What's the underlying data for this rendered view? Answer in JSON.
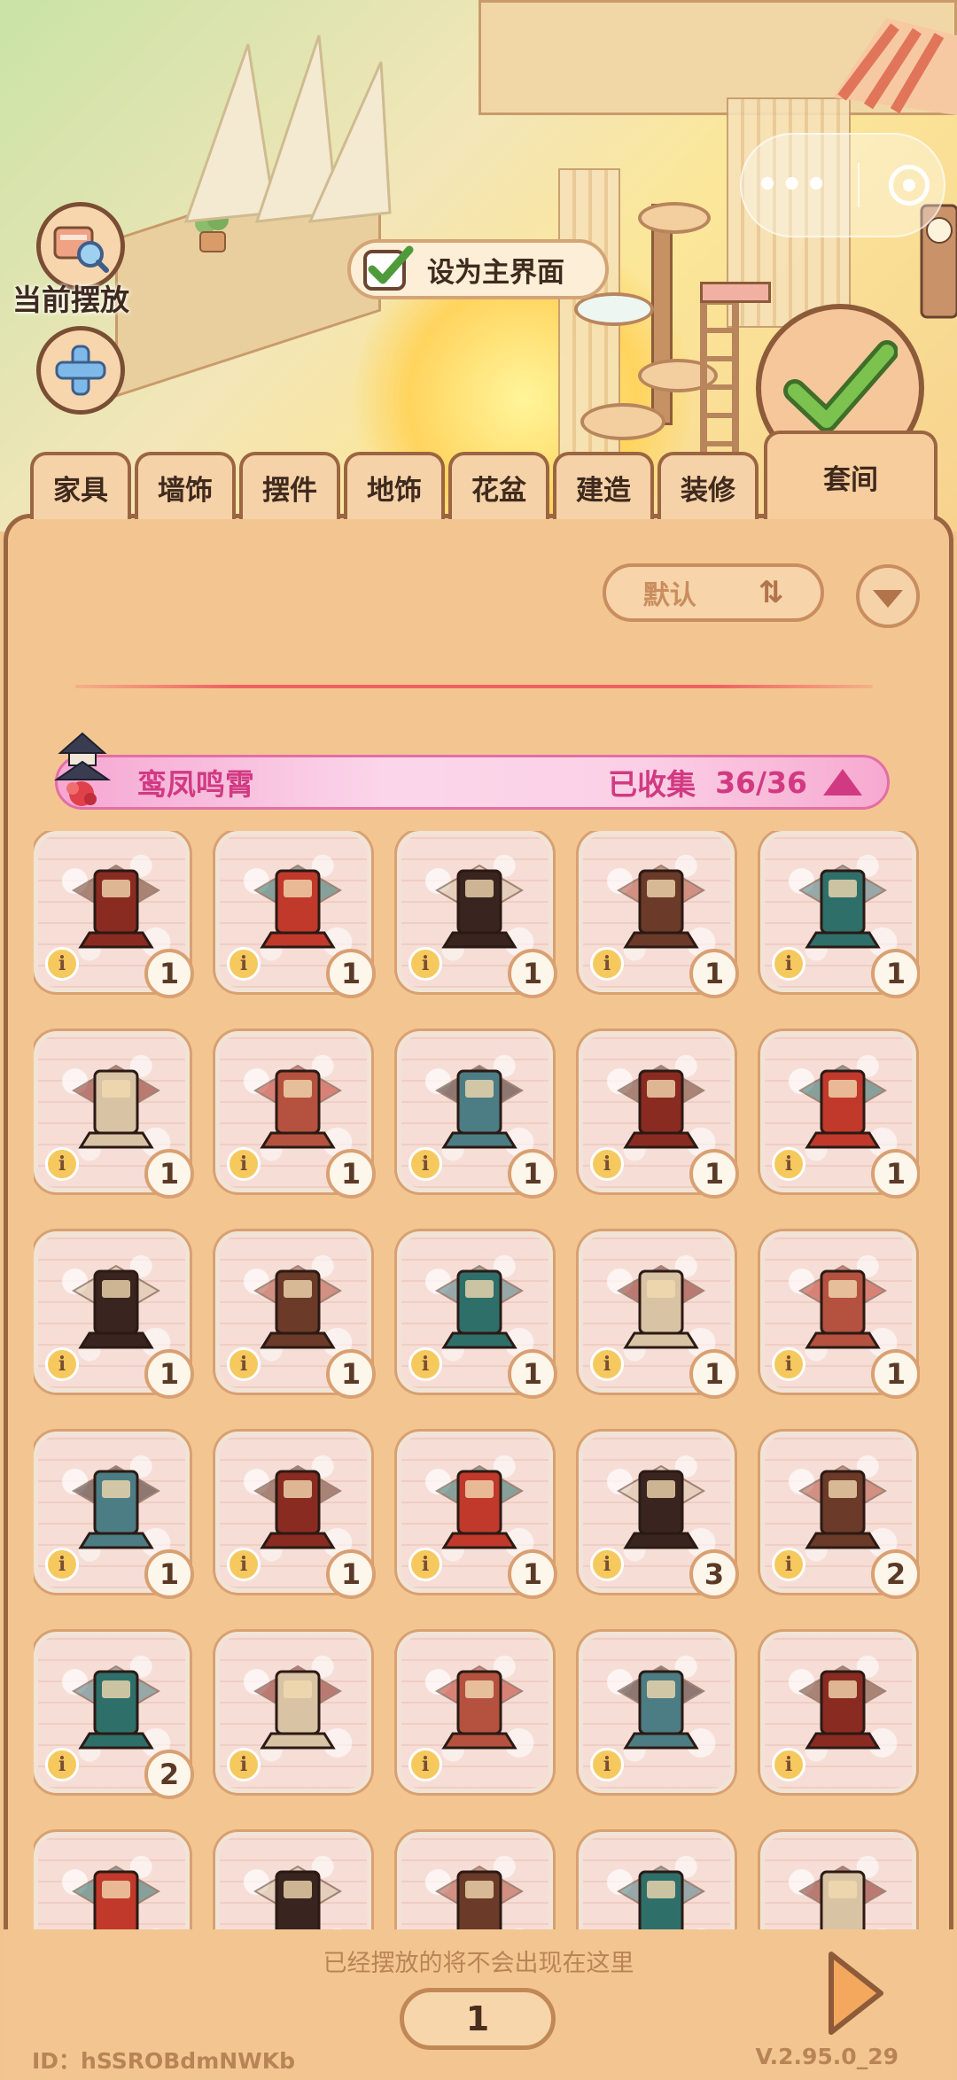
{
  "top": {
    "current_label": "当前摆放",
    "set_main_label": "设为主界面"
  },
  "tabs": [
    {
      "label": "家具"
    },
    {
      "label": "墙饰"
    },
    {
      "label": "摆件"
    },
    {
      "label": "地饰"
    },
    {
      "label": "花盆"
    },
    {
      "label": "建造"
    },
    {
      "label": "装修"
    },
    {
      "label": "套间",
      "active": true
    }
  ],
  "sort": {
    "label": "默认"
  },
  "set": {
    "name": "鸾凤鸣霄",
    "collected_label": "已收集",
    "count": "36/36"
  },
  "items": [
    {
      "icon": "lantern-chair-icon",
      "qty": "1"
    },
    {
      "icon": "vase-stand-icon",
      "qty": "1"
    },
    {
      "icon": "stone-lantern-icon",
      "qty": "1"
    },
    {
      "icon": "carved-chair-icon",
      "qty": "1"
    },
    {
      "icon": "plum-tree-icon",
      "qty": "1"
    },
    {
      "icon": "octagon-window-icon",
      "qty": "1"
    },
    {
      "icon": "carpet-icon",
      "qty": "1"
    },
    {
      "icon": "swing-icon",
      "qty": "1"
    },
    {
      "icon": "fountain-pool-icon",
      "qty": "1"
    },
    {
      "icon": "railing-icon",
      "qty": "1"
    },
    {
      "icon": "jade-discs-icon",
      "qty": "1"
    },
    {
      "icon": "long-table-icon",
      "qty": "1"
    },
    {
      "icon": "throne-chair-icon",
      "qty": "1"
    },
    {
      "icon": "bonsai-icon",
      "qty": "1"
    },
    {
      "icon": "daybed-icon",
      "qty": "1"
    },
    {
      "icon": "study-mat-icon",
      "qty": "1"
    },
    {
      "icon": "folding-screen-icon",
      "qty": "1"
    },
    {
      "icon": "armchair-icon",
      "qty": "1"
    },
    {
      "icon": "curtain-doorway-icon",
      "qty": "3"
    },
    {
      "icon": "tea-tray-icon",
      "qty": "2"
    },
    {
      "icon": "display-cabinet-icon",
      "qty": "2"
    },
    {
      "icon": "red-door-icon",
      "qty": ""
    },
    {
      "icon": "floor-tile-icon",
      "qty": ""
    },
    {
      "icon": "red-wall-icon",
      "qty": ""
    },
    {
      "icon": "feather-rug-icon",
      "qty": ""
    },
    {
      "icon": "snow-block-icon",
      "qty": ""
    },
    {
      "icon": "gate-wall-icon",
      "qty": ""
    },
    {
      "icon": "pagoda-icon",
      "qty": ""
    },
    {
      "icon": "white-fence-icon",
      "qty": ""
    },
    {
      "icon": "red-stairs-icon",
      "qty": ""
    }
  ],
  "footer": {
    "hint": "已经摆放的将不会出现在这里",
    "page": "1",
    "id_text": "ID：hSSROBdmNWKb",
    "version": "V.2.95.0_29"
  },
  "colors": {
    "panel": "#f3c691",
    "border": "#9b6542",
    "pink_accent": "#d13a82",
    "check_green": "#5cae3c"
  }
}
